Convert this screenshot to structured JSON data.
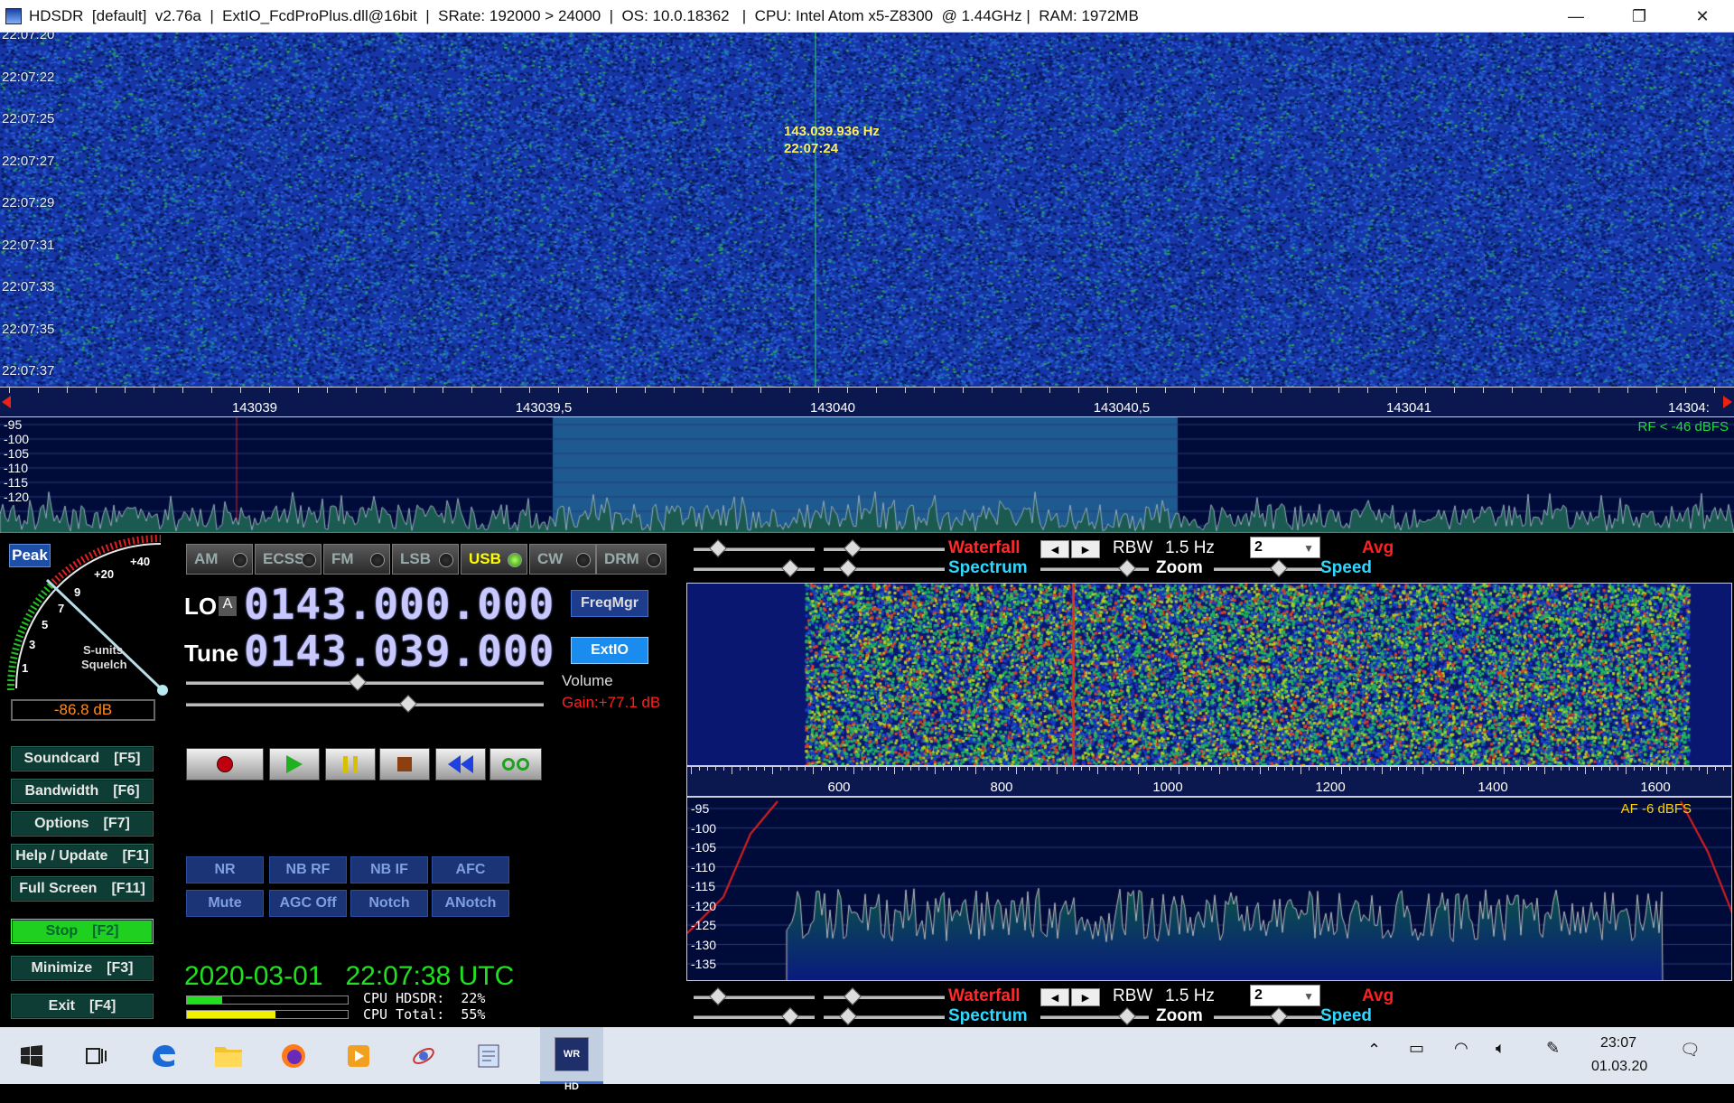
{
  "window": {
    "title": "HDSDR  [default]  v2.76a  |  ExtIO_FcdProPlus.dll@16bit  |  SRate: 192000 > 24000  |  OS: 10.0.18362   |  CPU: Intel Atom x5-Z8300  @ 1.44GHz |  RAM: 1972MB",
    "minimize": "—",
    "restore": "❐",
    "close": "✕"
  },
  "rf_waterfall": {
    "times": [
      "22:07:20",
      "22:07:22",
      "22:07:25",
      "22:07:27",
      "22:07:29",
      "22:07:31",
      "22:07:33",
      "22:07:35",
      "22:07:37"
    ],
    "cursor_freq": "143.039.936 Hz",
    "cursor_time": "22:07:24"
  },
  "rf_axis": {
    "labels": [
      "143039",
      "143039,5",
      "143040",
      "143040,5",
      "143041",
      "14304:"
    ]
  },
  "rf_spectrum": {
    "db_labels": [
      "-95",
      "-100",
      "-105",
      "-110",
      "-115",
      "-120"
    ],
    "rf_level": "RF < -46 dBFS"
  },
  "smeter": {
    "peak": "Peak",
    "scale": [
      "1",
      "3",
      "5",
      "7",
      "9",
      "+20",
      "+40"
    ],
    "caption1": "S-units",
    "caption2": "Squelch",
    "level": "-86.8 dB",
    "needle_fraction": 0.41
  },
  "left_buttons": [
    {
      "label": "Soundcard",
      "key": "[F5]"
    },
    {
      "label": "Bandwidth",
      "key": "[F6]"
    },
    {
      "label": "Options",
      "key": "[F7]"
    },
    {
      "label": "Help / Update",
      "key": "[F1]"
    },
    {
      "label": "Full Screen",
      "key": "[F11]"
    },
    {
      "label": "Stop",
      "key": "[F2]"
    },
    {
      "label": "Minimize",
      "key": "[F3]"
    },
    {
      "label": "Exit",
      "key": "[F4]"
    }
  ],
  "modes": [
    "AM",
    "ECSS",
    "FM",
    "LSB",
    "USB",
    "CW",
    "DRM"
  ],
  "active_mode": "USB",
  "lo": {
    "label": "LO",
    "tag": "A",
    "value": "0143.000.000"
  },
  "tune": {
    "label": "Tune",
    "value": "0143.039.000"
  },
  "freqmgr": "FreqMgr",
  "extio": "ExtIO",
  "volume": {
    "label": "Volume",
    "gain": "Gain:+77.1 dB",
    "volume_level": 0.48,
    "gain_level": 0.62
  },
  "dsp_row1": [
    "NR",
    "NB RF",
    "NB IF",
    "AFC"
  ],
  "dsp_row2": [
    "Mute",
    "AGC Off",
    "Notch",
    "ANotch"
  ],
  "clock": "2020-03-01   22:07:38 UTC",
  "cpu": {
    "hdsdr_text": "CPU HDSDR:  22%",
    "total_text": "CPU Total:  55%",
    "hdsdr": 0.22,
    "total": 0.55
  },
  "display_controls": {
    "waterfall": "Waterfall",
    "spectrum": "Spectrum",
    "rbw_label": "RBW",
    "rbw_value": "1.5 Hz",
    "avg_value": "2",
    "avg": "Avg",
    "zoom": "Zoom",
    "speed": "Speed"
  },
  "af_axis": {
    "labels": [
      "600",
      "800",
      "1000",
      "1200",
      "1400",
      "1600"
    ]
  },
  "af_spectrum": {
    "db_labels": [
      "-95",
      "-100",
      "-105",
      "-110",
      "-115",
      "-120",
      "-125",
      "-130",
      "-135"
    ],
    "af_level": "AF  -6 dBFS"
  },
  "taskbar": {
    "time": "23:07",
    "date": "01.03.20",
    "apps": [
      "start",
      "task-view",
      "edge",
      "file-explorer",
      "firefox",
      "media-player",
      "satellite-app",
      "notepad",
      "hdsdr"
    ],
    "hdsdr_badge": "WR HD"
  },
  "colors": {
    "waterfall_blue": "#1636a8",
    "mode_active": "#ffff00",
    "clock_green": "#20e020",
    "gain_red": "#ff2020",
    "waterfall_label_red": "#ff2a2a",
    "spectrum_label_cyan": "#30d8ff"
  }
}
